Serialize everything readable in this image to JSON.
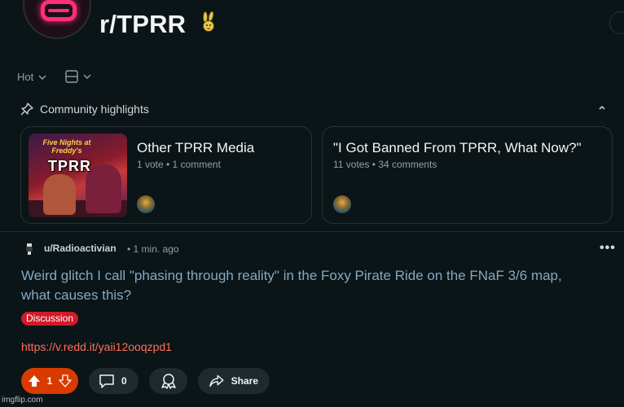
{
  "header": {
    "subreddit": "r/TPRR"
  },
  "sort": {
    "label": "Hot"
  },
  "highlights": {
    "label": "Community highlights",
    "cards": [
      {
        "title": "Other TPRR Media",
        "meta": "1 vote • 1 comment",
        "thumb_line1": "Five Nights at Freddy's",
        "thumb_line2": "TPRR"
      },
      {
        "title": "\"I Got Banned From TPRR, What Now?\"",
        "meta": "11 votes • 34 comments"
      }
    ]
  },
  "post": {
    "author": "u/Radioactivian",
    "time": "• 1 min. ago",
    "more": "•••",
    "title": "Weird glitch I call \"phasing through reality\" in the Foxy Pirate Ride on the FNaF 3/6 map, what causes this?",
    "flair": "Discussion",
    "link": "https://v.redd.it/yaii12ooqzpd1",
    "votes": "1",
    "comments": "0",
    "share_label": "Share"
  },
  "watermark": "imgflip.com",
  "colors": {
    "background": "#0b1416",
    "upvote_active": "#d93a00",
    "flair": "#d11a2a",
    "link": "#ff6f5c",
    "title_visited": "#85a9c4"
  },
  "icons": {
    "sort": "chevron-down-icon",
    "layout": "card-view-icon",
    "highlights": "pin-icon",
    "collapse": "chevron-up-icon",
    "upvote": "arrow-up-icon",
    "downvote": "arrow-down-icon",
    "comments": "speech-bubble-icon",
    "award": "award-icon",
    "share": "share-arrow-icon"
  }
}
